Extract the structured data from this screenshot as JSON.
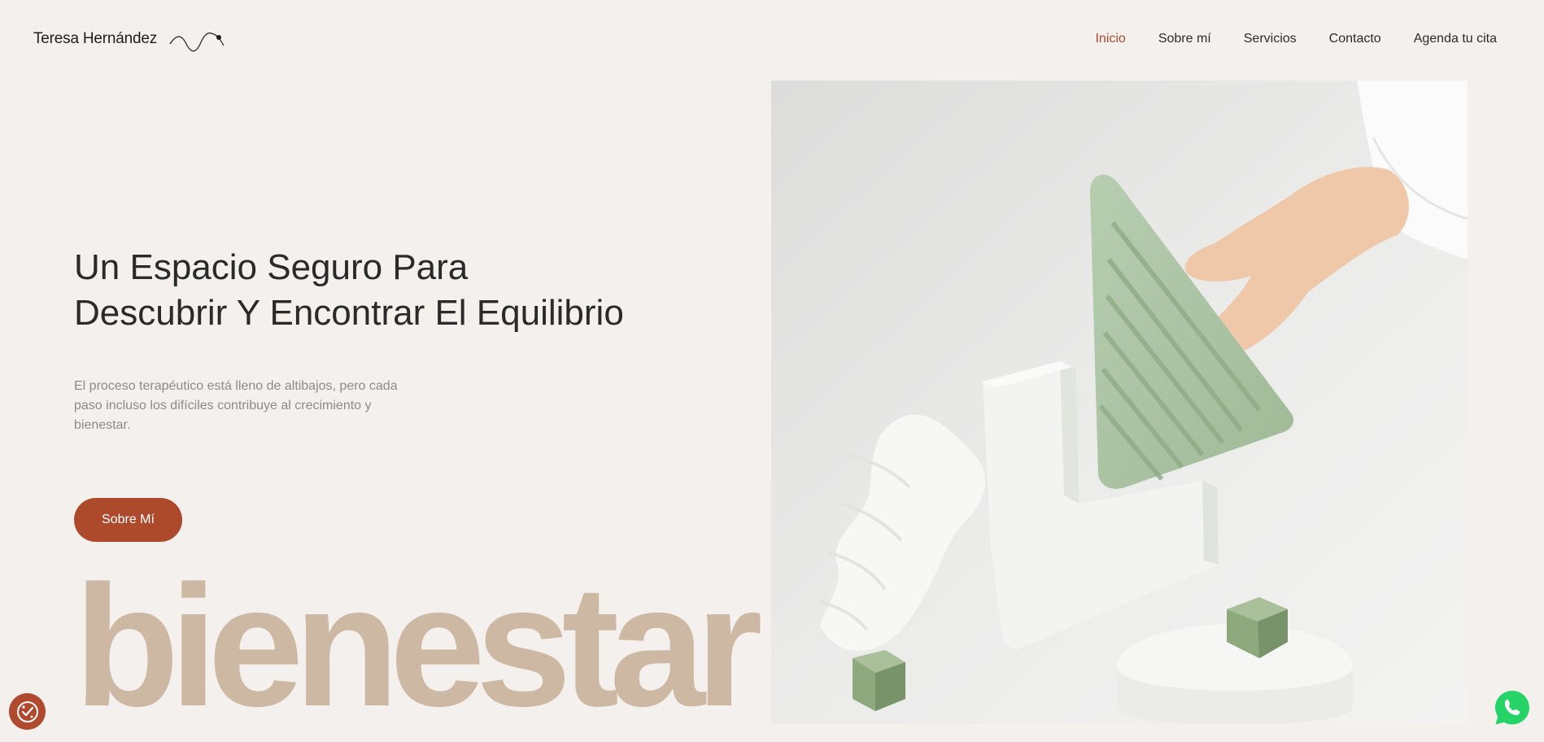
{
  "header": {
    "logo_text": "Teresa Hernández",
    "nav": [
      {
        "label": "Inicio",
        "active": true
      },
      {
        "label": "Sobre mí",
        "active": false
      },
      {
        "label": "Servicios",
        "active": false
      },
      {
        "label": "Contacto",
        "active": false
      },
      {
        "label": "Agenda tu cita",
        "active": false
      }
    ]
  },
  "hero": {
    "title_line1": "Un Espacio Seguro Para",
    "title_line2": "Descubrir Y Encontrar El Equilibrio",
    "description": "El proceso terapéutico está lleno de altibajos, pero cada paso incluso los difíciles contribuye al crecimiento y bienestar.",
    "cta_label": "Sobre Mí",
    "big_word": "bienestar"
  },
  "icons": {
    "cookie": "cookie-settings-icon",
    "whatsapp": "whatsapp-icon",
    "logo_mark": "wave-line-icon"
  },
  "colors": {
    "background": "#f4f0ed",
    "accent": "#ad4a2c",
    "big_word": "#cdb8a3",
    "whatsapp": "#25d366"
  }
}
